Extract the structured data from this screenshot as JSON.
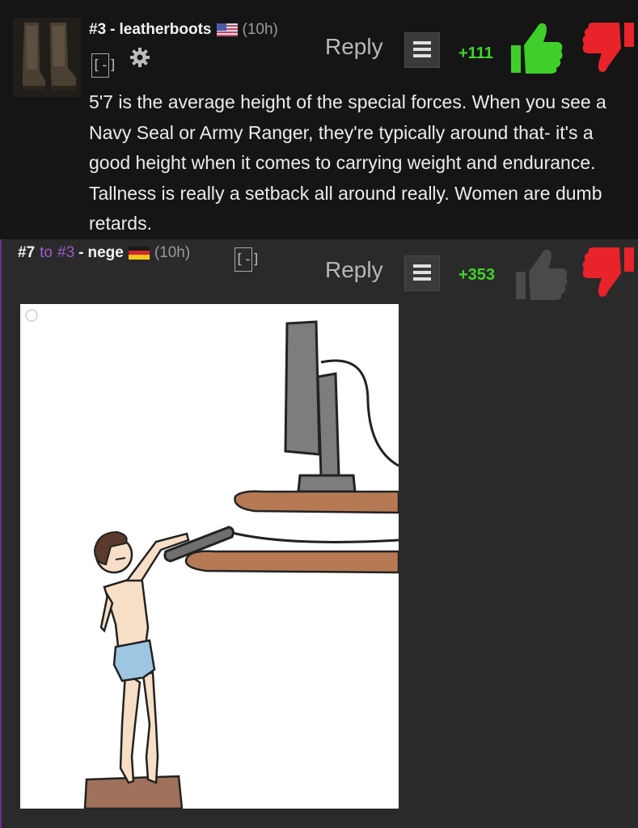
{
  "comment": {
    "number": "#3",
    "separator": "-",
    "username": "leatherboots",
    "flag": "us-flag",
    "time": "(10h)",
    "collapse": "[-]",
    "reply_label": "Reply",
    "score": "+111",
    "body": "5'7 is the average height of the special forces. When you see a Navy Seal or Army Ranger, they're typically around that- it's a good height when it comes to carrying weight and endurance. Tallness is really a setback all around really. Women are dumb retards."
  },
  "reply": {
    "number": "#7",
    "to_label": "to",
    "to_number": "#3",
    "separator": "-",
    "username": "nege",
    "flag": "german-flag",
    "time": "(10h)",
    "collapse": "[-]",
    "reply_label": "Reply",
    "score": "+353",
    "image": "meme-drawing-short-man-reaching-monitor"
  },
  "colors": {
    "background": "#161616",
    "reply_background": "#2a2a2a",
    "score_green": "#3ed62b",
    "upvote_green": "#3fcf2a",
    "downvote_red": "#e8232a",
    "link_purple": "#9a5ccf"
  }
}
